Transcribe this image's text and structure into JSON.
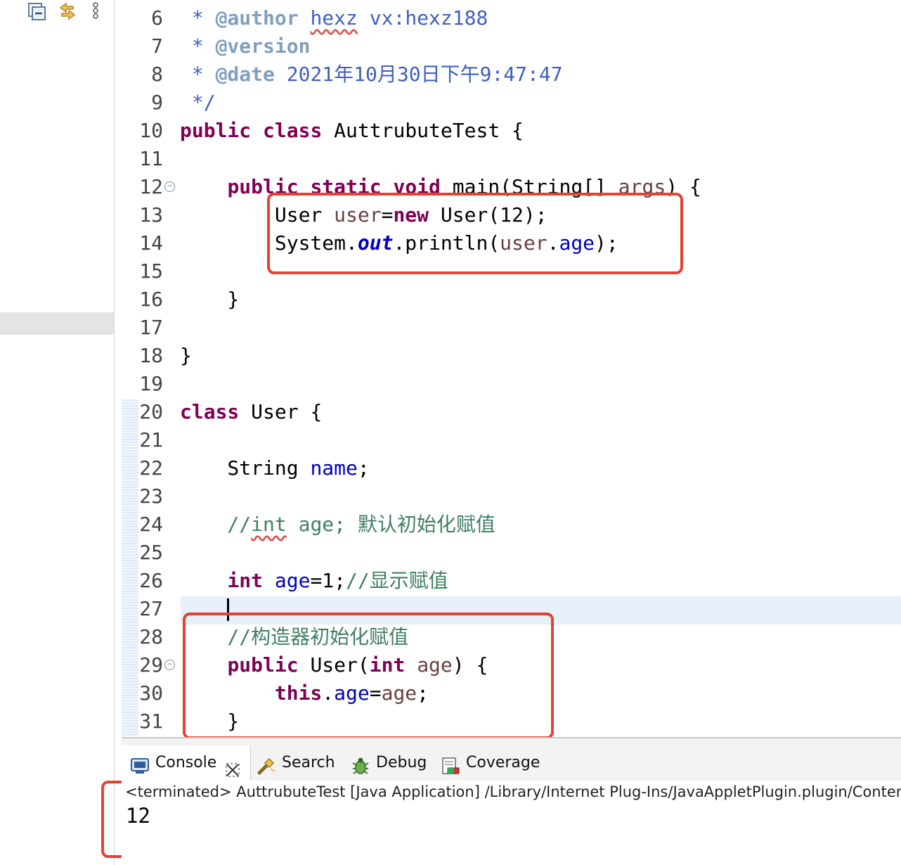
{
  "toolbar": {
    "icons": [
      "collapse-all-icon",
      "link-with-editor-icon",
      "view-menu-icon"
    ]
  },
  "editor": {
    "lines": [
      {
        "n": "6",
        "segs": [
          {
            "t": " * ",
            "c": "doc"
          },
          {
            "t": "@author",
            "c": "doctag"
          },
          {
            "t": " ",
            "c": "doc"
          },
          {
            "t": "hexz",
            "c": "doc spell"
          },
          {
            "t": " vx:hexz188",
            "c": "doc"
          }
        ]
      },
      {
        "n": "7",
        "segs": [
          {
            "t": " * ",
            "c": "doc"
          },
          {
            "t": "@version",
            "c": "doctag"
          }
        ]
      },
      {
        "n": "8",
        "segs": [
          {
            "t": " * ",
            "c": "doc"
          },
          {
            "t": "@date",
            "c": "doctag"
          },
          {
            "t": " 2021年10月30日下午9:47:47",
            "c": "doc"
          }
        ]
      },
      {
        "n": "9",
        "segs": [
          {
            "t": " */",
            "c": "doc"
          }
        ]
      },
      {
        "n": "10",
        "segs": [
          {
            "t": "public",
            "c": "kw"
          },
          {
            "t": " "
          },
          {
            "t": "class",
            "c": "kw"
          },
          {
            "t": " AuttrubuteTest {"
          }
        ]
      },
      {
        "n": "11",
        "segs": []
      },
      {
        "n": "12",
        "fold": true,
        "segs": [
          {
            "t": "    "
          },
          {
            "t": "public",
            "c": "kw"
          },
          {
            "t": " "
          },
          {
            "t": "static",
            "c": "kw"
          },
          {
            "t": " "
          },
          {
            "t": "void",
            "c": "kw"
          },
          {
            "t": " main(String[] "
          },
          {
            "t": "args",
            "c": "var"
          },
          {
            "t": ") {"
          }
        ]
      },
      {
        "n": "13",
        "segs": [
          {
            "t": "        User "
          },
          {
            "t": "user",
            "c": "var"
          },
          {
            "t": "="
          },
          {
            "t": "new",
            "c": "kw"
          },
          {
            "t": " User(12);"
          }
        ]
      },
      {
        "n": "14",
        "segs": [
          {
            "t": "        System."
          },
          {
            "t": "out",
            "c": "sfld"
          },
          {
            "t": ".println("
          },
          {
            "t": "user",
            "c": "var"
          },
          {
            "t": "."
          },
          {
            "t": "age",
            "c": "fld"
          },
          {
            "t": ");"
          }
        ]
      },
      {
        "n": "15",
        "segs": []
      },
      {
        "n": "16",
        "segs": [
          {
            "t": "    }"
          }
        ]
      },
      {
        "n": "17",
        "segs": []
      },
      {
        "n": "18",
        "segs": [
          {
            "t": "}"
          }
        ]
      },
      {
        "n": "19",
        "segs": []
      },
      {
        "n": "20",
        "segs": [
          {
            "t": "class",
            "c": "kw"
          },
          {
            "t": " User {"
          }
        ]
      },
      {
        "n": "21",
        "segs": []
      },
      {
        "n": "22",
        "segs": [
          {
            "t": "    String "
          },
          {
            "t": "name",
            "c": "fld"
          },
          {
            "t": ";"
          }
        ]
      },
      {
        "n": "23",
        "segs": []
      },
      {
        "n": "24",
        "segs": [
          {
            "t": "    //",
            "c": "cmt"
          },
          {
            "t": "int",
            "c": "cmt spell"
          },
          {
            "t": " age; 默认初始化赋值",
            "c": "cmt"
          }
        ]
      },
      {
        "n": "25",
        "segs": []
      },
      {
        "n": "26",
        "segs": [
          {
            "t": "    "
          },
          {
            "t": "int",
            "c": "kw"
          },
          {
            "t": " "
          },
          {
            "t": "age",
            "c": "fld"
          },
          {
            "t": "=1;"
          },
          {
            "t": "//显示赋值",
            "c": "cmt"
          }
        ]
      },
      {
        "n": "27",
        "caret": true,
        "segs": [
          {
            "t": "    "
          }
        ]
      },
      {
        "n": "28",
        "segs": [
          {
            "t": "    //构造器初始化赋值",
            "c": "cmt"
          }
        ]
      },
      {
        "n": "29",
        "fold": true,
        "segs": [
          {
            "t": "    "
          },
          {
            "t": "public",
            "c": "kw"
          },
          {
            "t": " User("
          },
          {
            "t": "int",
            "c": "kw"
          },
          {
            "t": " "
          },
          {
            "t": "age",
            "c": "var"
          },
          {
            "t": ") {"
          }
        ]
      },
      {
        "n": "30",
        "segs": [
          {
            "t": "        "
          },
          {
            "t": "this",
            "c": "kw"
          },
          {
            "t": "."
          },
          {
            "t": "age",
            "c": "fld"
          },
          {
            "t": "="
          },
          {
            "t": "age",
            "c": "var"
          },
          {
            "t": ";"
          }
        ]
      },
      {
        "n": "31",
        "segs": [
          {
            "t": "    }"
          }
        ]
      }
    ]
  },
  "tabs": [
    {
      "label": "Console",
      "icon": "console-icon",
      "active": true,
      "close_icon": "close-icon"
    },
    {
      "label": "Search",
      "icon": "search-flashlight-icon"
    },
    {
      "label": "Debug",
      "icon": "debug-bug-icon"
    },
    {
      "label": "Coverage",
      "icon": "coverage-icon"
    }
  ],
  "console": {
    "status": "<terminated> AuttrubuteTest [Java Application] /Library/Internet Plug-Ins/JavaAppletPlugin.plugin/Conten",
    "output": "12"
  },
  "colors": {
    "highlight_box": "#e5422f",
    "keyword": "#7f0055",
    "javadoc": "#3f5fbf",
    "comment": "#3f7f5f",
    "field": "#0000c0"
  }
}
